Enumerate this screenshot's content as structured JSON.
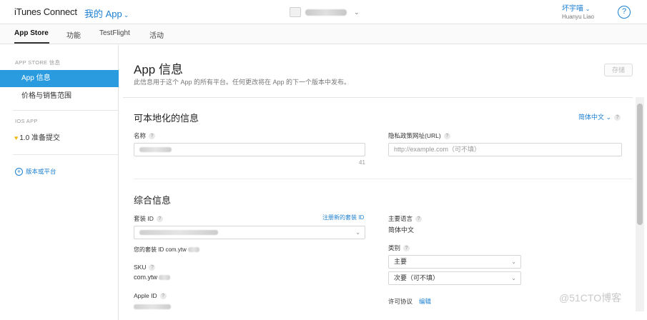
{
  "header": {
    "brand": "iTunes Connect",
    "my_app": "我的 App",
    "user_name": "坏宇喵",
    "user_sub": "Huanyu Liao",
    "help": "?"
  },
  "subnav": {
    "tabs": [
      "App Store",
      "功能",
      "TestFlight",
      "活动"
    ],
    "active": "App Store"
  },
  "sidebar": {
    "section1": "APP STORE 信息",
    "items": [
      "App 信息",
      "价格与销售范围"
    ],
    "section2": "IOS APP",
    "version_item": "1.0 准备提交",
    "add_label": "版本或平台"
  },
  "main": {
    "title": "App 信息",
    "description": "此信息用于这个 App 的所有平台。任何更改将在 App 的下一个版本中发布。",
    "save": "存储",
    "localizable": {
      "title": "可本地化的信息",
      "lang": "简体中文",
      "name_label": "名称",
      "char_count": "41",
      "privacy_label": "隐私政策网址(URL)",
      "privacy_placeholder": "http://example.com（可不填）"
    },
    "general": {
      "title": "综合信息",
      "bundle_label": "套装 ID",
      "register_link": "注册新的套装 ID",
      "bundle_prefix": "您的套装 ID com.ytw",
      "sku_label": "SKU",
      "sku_value": "com.ytw",
      "apple_id_label": "Apple ID",
      "primary_lang_label": "主要语言",
      "primary_lang_value": "简体中文",
      "category_label": "类别",
      "category_primary": "主要",
      "category_secondary": "次要（可不填）",
      "license_label": "许可协议",
      "license_edit": "编辑"
    }
  },
  "watermark": "@51CTO博客",
  "colors": {
    "accent": "#1b7fd1",
    "active_side": "#2b9be0"
  }
}
